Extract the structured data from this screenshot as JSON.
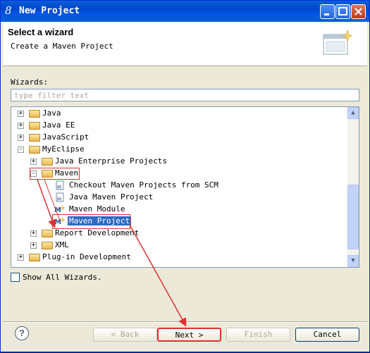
{
  "window": {
    "title": "New Project"
  },
  "header": {
    "title": "Select a wizard",
    "description": "Create a Maven Project"
  },
  "wizards_label": "Wizards:",
  "filter": {
    "placeholder": "type filter text",
    "value": ""
  },
  "tree": {
    "items": [
      {
        "label": "Java",
        "toggle": "+"
      },
      {
        "label": "Java EE",
        "toggle": "+"
      },
      {
        "label": "JavaScript",
        "toggle": "+"
      },
      {
        "label": "MyEclipse",
        "toggle": "-"
      },
      {
        "label": "Java Enterprise Projects",
        "toggle": "+"
      },
      {
        "label": "Maven",
        "toggle": "-"
      },
      {
        "label": "Checkout Maven Projects from SCM"
      },
      {
        "label": "Java Maven Project"
      },
      {
        "label": "Maven Module"
      },
      {
        "label": "Maven Project",
        "selected": true
      },
      {
        "label": "Report Development",
        "toggle": "+"
      },
      {
        "label": "XML",
        "toggle": "+"
      },
      {
        "label": "Plug-in Development",
        "toggle": "+"
      }
    ]
  },
  "show_all_label": "Show All Wizards.",
  "buttons": {
    "back": "< Back",
    "next": "Next >",
    "finish": "Finish",
    "cancel": "Cancel",
    "help": "?"
  },
  "colors": {
    "selection": "#316ac5",
    "annotation": "#e03030",
    "titlebar": "#0054e3"
  }
}
